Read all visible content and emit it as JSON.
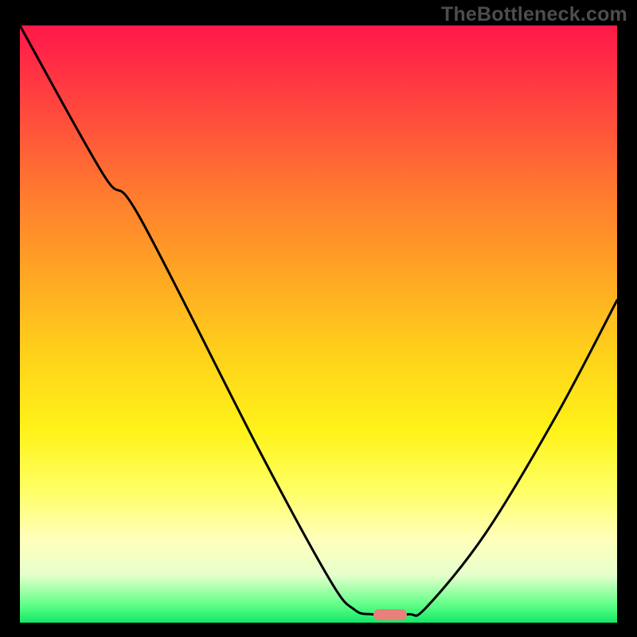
{
  "watermark": "TheBottleneck.com",
  "chart_data": {
    "type": "line",
    "title": "",
    "xlabel": "",
    "ylabel": "",
    "xlim": [
      0,
      100
    ],
    "ylim": [
      0,
      100
    ],
    "grid": false,
    "line_color": "#000000",
    "marker": {
      "x_pct": 62,
      "y_pct": 98.6,
      "color": "#e98079"
    },
    "background_gradient": [
      "#ff1a49",
      "#ff7a2f",
      "#ffd11a",
      "#fff319",
      "#ffffbb",
      "#11e866"
    ],
    "series": [
      {
        "name": "curve",
        "points": [
          {
            "x_pct": 0,
            "y_pct": 0,
            "value_pct": 100
          },
          {
            "x_pct": 14,
            "y_pct": 25,
            "value_pct": 75
          },
          {
            "x_pct": 20,
            "y_pct": 32,
            "value_pct": 68
          },
          {
            "x_pct": 40,
            "y_pct": 71,
            "value_pct": 29
          },
          {
            "x_pct": 52,
            "y_pct": 93,
            "value_pct": 7
          },
          {
            "x_pct": 56,
            "y_pct": 97.8,
            "value_pct": 2.2
          },
          {
            "x_pct": 59,
            "y_pct": 98.6,
            "value_pct": 1.4
          },
          {
            "x_pct": 65,
            "y_pct": 98.6,
            "value_pct": 1.4
          },
          {
            "x_pct": 68,
            "y_pct": 97.5,
            "value_pct": 2.5
          },
          {
            "x_pct": 78,
            "y_pct": 85,
            "value_pct": 15
          },
          {
            "x_pct": 90,
            "y_pct": 65,
            "value_pct": 35
          },
          {
            "x_pct": 100,
            "y_pct": 46,
            "value_pct": 54
          }
        ]
      }
    ]
  }
}
